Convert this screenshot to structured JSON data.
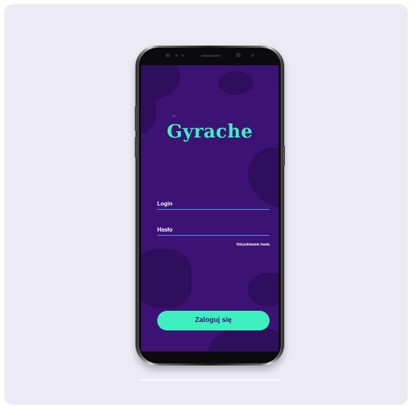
{
  "app": {
    "logo_text": "Gyrache",
    "accent_color": "#3ef0c0",
    "background_color": "#3d1275"
  },
  "form": {
    "login_label": "Login",
    "login_value": "",
    "password_label": "Hasło",
    "password_value": "",
    "recover_password_link": "Odzyskiwanie hasła"
  },
  "actions": {
    "login_button_label": "Zaloguj się"
  },
  "device": {
    "type": "smartphone-mockup"
  }
}
